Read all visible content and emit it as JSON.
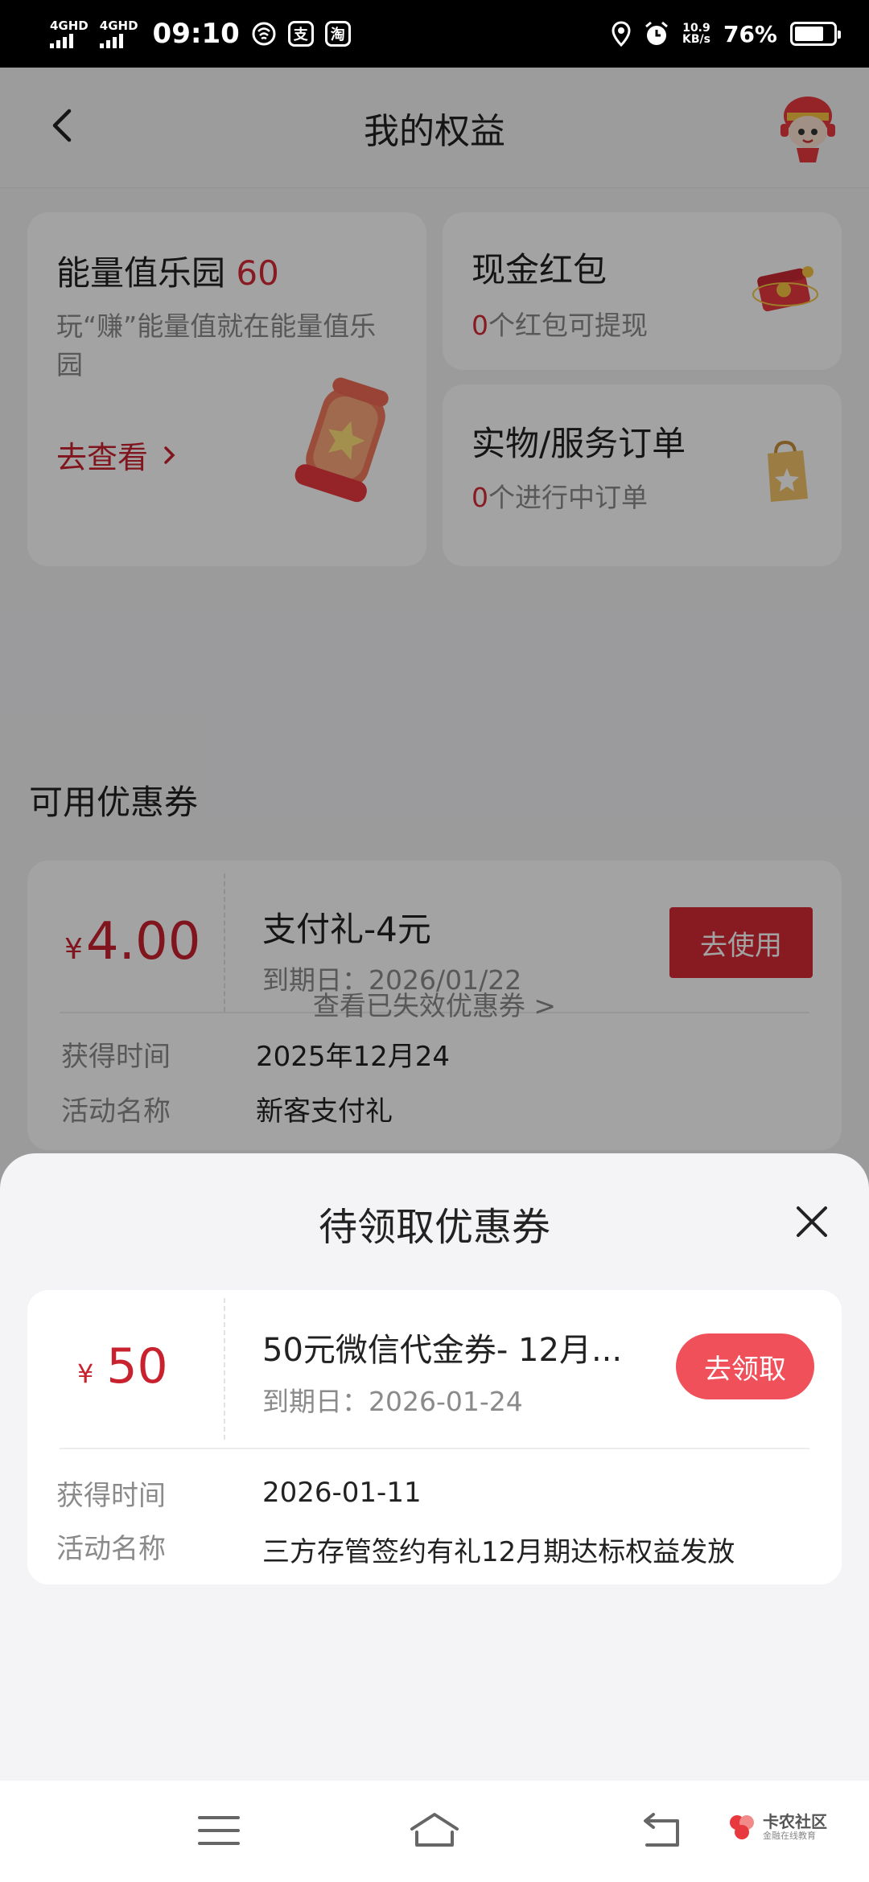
{
  "status_bar": {
    "network_1": "4GHD",
    "network_2": "4GHD",
    "time": "09:10",
    "app_icon_alipay": "支",
    "app_icon_taobao": "淘",
    "net_speed_value": "10.9",
    "net_speed_unit": "KB/s",
    "battery_text": "76%",
    "battery_level": 0.76
  },
  "header": {
    "title": "我的权益"
  },
  "energy_card": {
    "title": "能量值乐园",
    "value": "60",
    "description": "玩“赚”能量值就在能量值乐园",
    "link": "去查看"
  },
  "cash_card": {
    "title": "现金红包",
    "count": "0",
    "suffix": "个红包可提现"
  },
  "order_card": {
    "title": "实物/服务订单",
    "count": "0",
    "suffix": "个进行中订单"
  },
  "available_coupons": {
    "section_title": "可用优惠券",
    "coupon": {
      "currency": "¥",
      "amount": "4.00",
      "name": "支付礼-4元",
      "expiry": "到期日：2026/01/22",
      "button": "去使用",
      "acquired_label": "获得时间",
      "acquired_value": "2025年12月24",
      "activity_label": "活动名称",
      "activity_value": "新客支付礼"
    },
    "expired_link": "查看已失效优惠券 >"
  },
  "pending_sheet": {
    "title": "待领取优惠券",
    "coupon": {
      "currency": "¥",
      "amount": "50",
      "name": "50元微信代金券- 12月...",
      "expiry": "到期日：2026-01-24",
      "button": "去领取",
      "acquired_label": "获得时间",
      "acquired_value": "2026-01-11",
      "activity_label": "活动名称",
      "activity_value": "三方存管签约有礼12月期达标权益发放"
    }
  },
  "watermark": {
    "main": "卡农社区",
    "sub": "金融在线教育"
  },
  "colors": {
    "accent_red": "#d52b36",
    "claim_red": "#f0505a"
  }
}
